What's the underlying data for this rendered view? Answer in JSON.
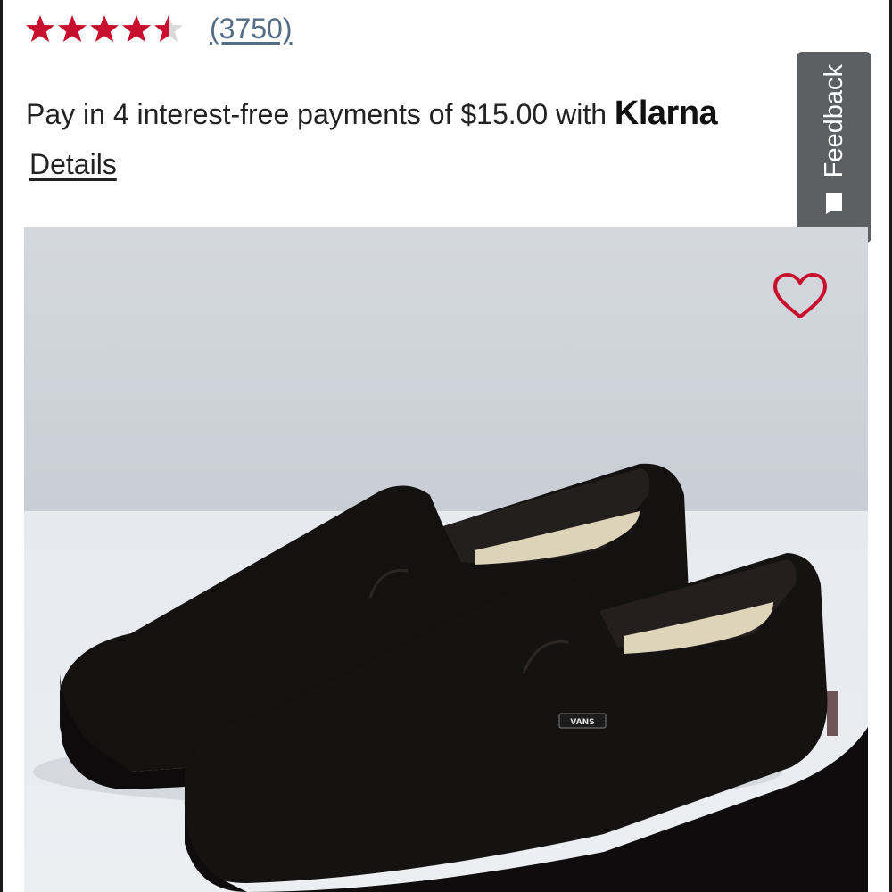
{
  "rating": {
    "stars_value": 4.5,
    "stars_max": 5,
    "star_color": "#c8102e",
    "review_count": "(3750)"
  },
  "payment": {
    "text": "Pay in 4 interest-free payments of $15.00 with ",
    "brand": "Klarna",
    "details_label": "Details"
  },
  "feedback": {
    "label": "Feedback",
    "icon": "feedback-icon"
  },
  "product": {
    "image_icon": "black-slip-on-shoes",
    "shoe_logo_text": "VANS",
    "favorite_icon": "heart-outline-icon",
    "favorite_color": "#c8102e"
  }
}
